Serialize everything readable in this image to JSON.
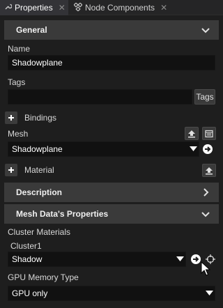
{
  "tabs": [
    {
      "label": "Properties",
      "icon": "wrench-icon",
      "close": "✕"
    },
    {
      "label": "Node Components",
      "icon": "diamond-nodes-icon",
      "close": "✕"
    }
  ],
  "general": {
    "header": "General",
    "name_label": "Name",
    "name_value": "Shadowplane",
    "tags_label": "Tags",
    "tags_value": "",
    "tags_button": "Tags",
    "bindings_label": "Bindings",
    "mesh_label": "Mesh",
    "mesh_value": "Shadowplane",
    "material_label": "Material"
  },
  "description": {
    "header": "Description"
  },
  "mesh_data": {
    "header": "Mesh Data's Properties",
    "cluster_materials_label": "Cluster Materials",
    "cluster1_label": "Cluster1",
    "cluster1_value": "Shadow",
    "gpu_memory_label": "GPU Memory Type",
    "gpu_memory_value": "GPU only"
  },
  "colors": {
    "background": "#1e1e1e",
    "section_header": "#3a3a3a",
    "field": "#111111"
  }
}
